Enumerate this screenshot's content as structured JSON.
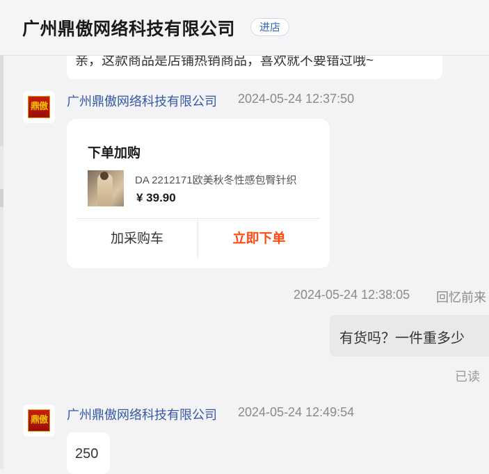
{
  "header": {
    "shop_name": "广州鼎傲网络科技有限公司",
    "enter_store_label": "进店"
  },
  "messages": {
    "partial_text": "亲，这款商品是店铺热销商品，喜欢就不要错过哦~",
    "msg1": {
      "sender": "广州鼎傲网络科技有限公司",
      "time": "2024-05-24 12:37:50",
      "avatar_text": "鼎傲"
    },
    "card": {
      "title": "下单加购",
      "product_name": "DA 2212171欧美秋冬性感包臀针织",
      "price": "¥ 39.90",
      "add_cart_label": "加采购车",
      "order_now_label": "立即下单"
    },
    "msg2": {
      "time": "2024-05-24 12:38:05",
      "user": "回忆前来",
      "text": "有货吗？一件重多少",
      "status": "已读"
    },
    "msg3": {
      "sender": "广州鼎傲网络科技有限公司",
      "time": "2024-05-24 12:49:54",
      "avatar_text": "鼎傲",
      "text": "250"
    }
  },
  "colors": {
    "accent_blue": "#3358a8",
    "order_orange": "#ff4a10"
  }
}
